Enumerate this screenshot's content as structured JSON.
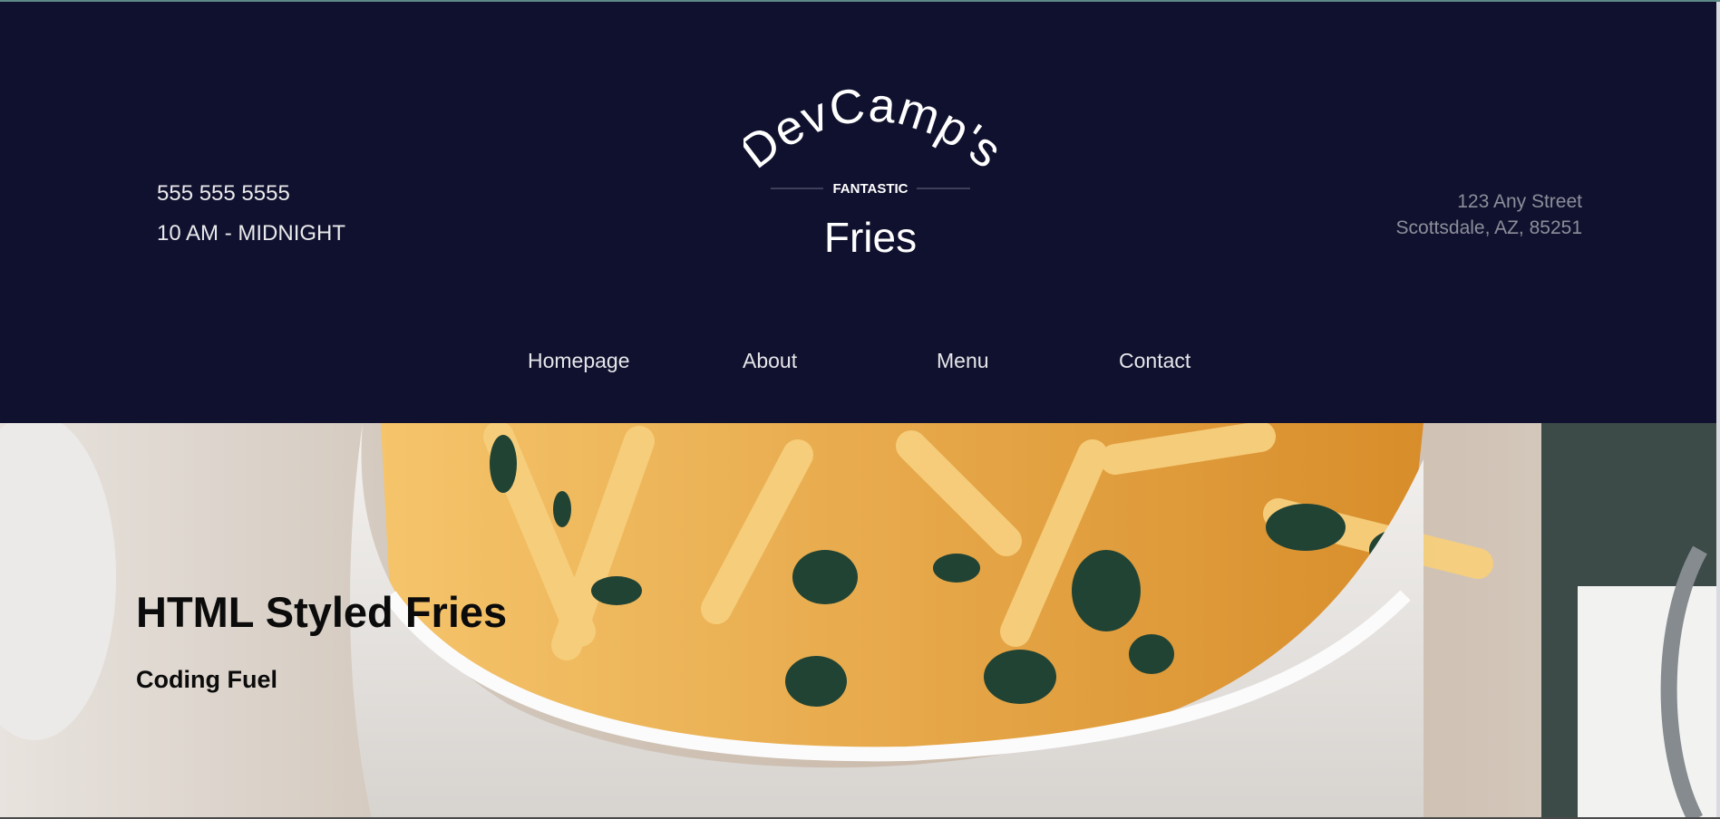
{
  "header": {
    "phone": "555 555 5555",
    "hours": "10 AM - MIDNIGHT",
    "address_line1": "123 Any Street",
    "address_line2": "Scottsdale, AZ, 85251"
  },
  "logo": {
    "top": "DevCamp's",
    "middle": "FANTASTIC",
    "bottom": "Fries"
  },
  "nav": {
    "items": [
      {
        "label": "Homepage"
      },
      {
        "label": "About"
      },
      {
        "label": "Menu"
      },
      {
        "label": "Contact"
      }
    ]
  },
  "hero": {
    "title": "HTML Styled Fries",
    "subtitle": "Coding Fuel"
  },
  "colors": {
    "header_bg": "#10112e",
    "header_text": "#e9e9ec",
    "address_text": "#8d8e9a",
    "hero_text": "#0b0b0b"
  }
}
